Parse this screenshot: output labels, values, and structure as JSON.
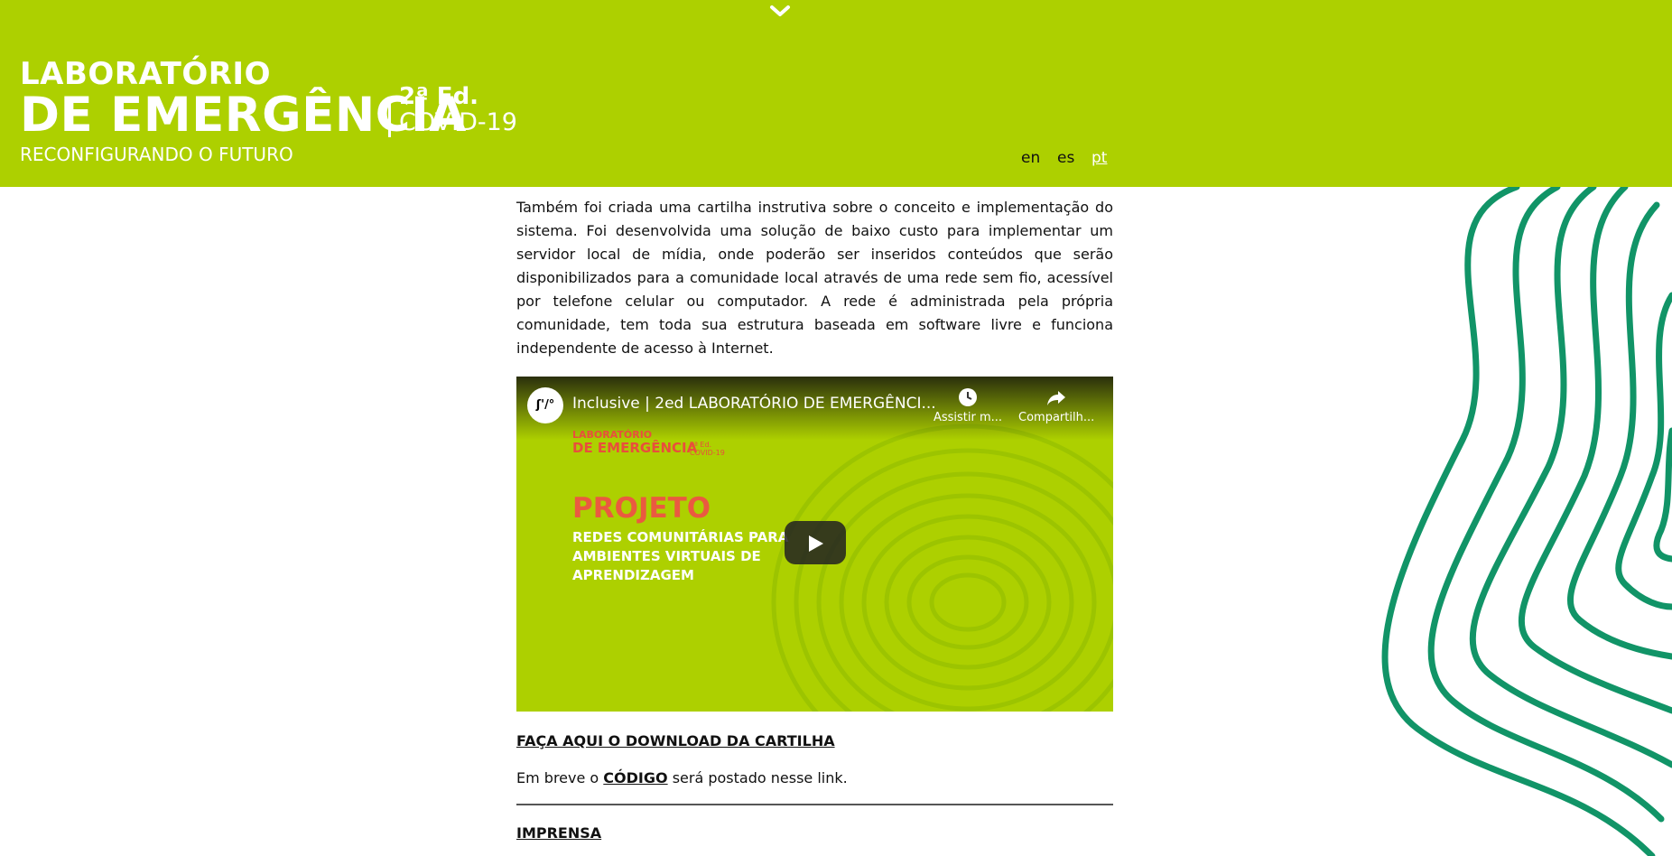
{
  "header": {
    "logo_line1": "LABORATÓRIO",
    "logo_line2": "DE EMERGÊNCIA",
    "edition": "2ª Ed.",
    "subtitle": "COVID-19",
    "tagline": "RECONFIGURANDO O FUTURO",
    "languages": [
      {
        "code": "en",
        "active": false
      },
      {
        "code": "es",
        "active": false
      },
      {
        "code": "pt",
        "active": true
      }
    ],
    "accent_color": "#add000"
  },
  "content": {
    "paragraph": "Também foi criada uma cartilha instrutiva sobre o conceito e implementação do sistema. Foi desenvolvida uma solução de baixo custo para implementar um servidor local de mídia, onde poderão ser inseridos conteúdos que serão disponibilizados para a comunidade local através de uma rede sem fio, acessível por telefone celular ou computador. A rede é administrada pela própria comunidade, tem toda sua estrutura baseada em software livre e funciona independente de acesso à Internet.",
    "video": {
      "channel_logo": "ʃ'/°",
      "title": "Inclusive | 2ed LABORATÓRIO DE EMERGÊNCI...",
      "watch_later_label": "Assistir m...",
      "share_label": "Compartilh...",
      "thumb_logo_line1": "LABORATÓRIO",
      "thumb_logo_line2": "DE EMERGÊNCIA",
      "thumb_logo_edition": "2ª Ed.",
      "thumb_logo_subtitle": "COVID-19",
      "thumb_heading": "PROJETO",
      "thumb_lines": [
        "REDES COMUNITÁRIAS PARA",
        "AMBIENTES VIRTUAIS DE",
        "APRENDIZAGEM"
      ]
    },
    "download_link": "FAÇA AQUI O DOWNLOAD DA CARTILHA",
    "code_prefix": "Em breve o",
    "code_link": "CÓDIGO",
    "code_suffix": "será postado nesse link.",
    "press_link": "IMPRENSA"
  },
  "decoration": {
    "wave_color": "#119467"
  }
}
